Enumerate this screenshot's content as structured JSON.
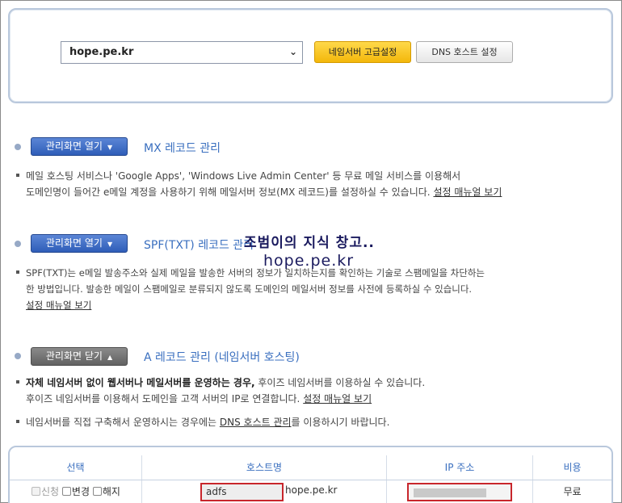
{
  "top": {
    "domain_selected": "hope.pe.kr",
    "ns_button": "네임서버 고급설정",
    "dns_button": "DNS 호스트 설정"
  },
  "sections": [
    {
      "toggle": "관리화면 열기",
      "title": "MX 레코드 관리",
      "desc_line1": "메일 호스팅 서비스나 'Google Apps', 'Windows Live Admin Center' 등 무료 메일 서비스를 이용해서",
      "desc_line2": "도메인명이 들어간 e메일 계정을 사용하기 위해 메일서버 정보(MX 레코드)를 설정하실 수 있습니다.",
      "link": "설정 매뉴얼 보기"
    },
    {
      "toggle": "관리화면 열기",
      "title": "SPF(TXT) 레코드 관리",
      "desc_line1": "SPF(TXT)는 e메일 발송주소와 실제 메일을 발송한 서버의 정보가 일치하는지를 확인하는 기술로 스팸메일을 차단하는",
      "desc_line2": "한 방법입니다. 발송한 메일이 스팸메일로 분류되지 않도록 도메인의 메일서버 정보를 사전에 등록하실 수 있습니다.",
      "link": "설정 매뉴얼 보기"
    },
    {
      "toggle": "관리화면 닫기",
      "title": "A 레코드 관리 (네임서버 호스팅)",
      "desc_bold": "자체 네임서버 없이 웹서버나 메일서버를 운영하는 경우,",
      "desc_line1_rest": " 후이즈 네임서버를 이용하실 수 있습니다.",
      "desc_line2": "후이즈 네임서버를 이용해서 도메인을 고객 서버의 IP로 연결합니다.",
      "link": "설정 매뉴얼 보기",
      "desc3_pre": "네임서버를 직접 구축해서 운영하시는 경우에는 ",
      "desc3_link": "DNS 호스트 관리",
      "desc3_post": "를 이용하시기 바랍니다."
    }
  ],
  "watermark": {
    "line1": "조범이의 지식 창고..",
    "line2": "hope.pe.kr"
  },
  "table": {
    "headers": [
      "선택",
      "호스트명",
      "IP 주소",
      "비용"
    ],
    "row": {
      "opt_new": "신청",
      "opt_change": "변경",
      "opt_cancel": "해지",
      "host_value": "adfs",
      "host_suffix": "hope.pe.kr",
      "cost": "무료"
    }
  },
  "colors": {
    "accent_blue": "#3a6fbf",
    "ns_button": "#f3b70b",
    "highlight_red": "#c8262c"
  }
}
